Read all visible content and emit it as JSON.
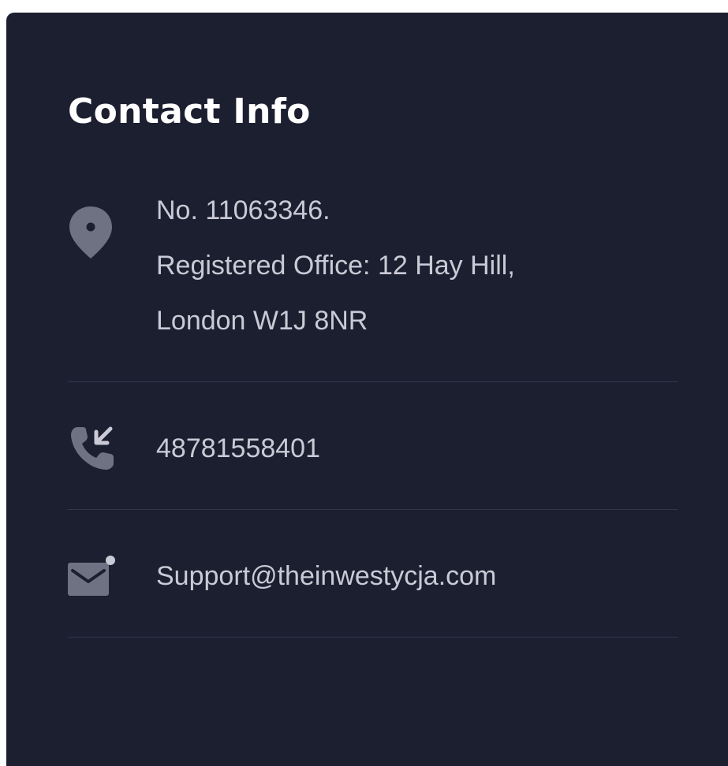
{
  "contact": {
    "title": "Contact Info",
    "address": {
      "icon": "location-pin-icon",
      "lines": [
        "No. 11063346.",
        "Registered Office: 12 Hay Hill,",
        "London W1J 8NR"
      ]
    },
    "phone": {
      "icon": "phone-incoming-icon",
      "value": "48781558401"
    },
    "email": {
      "icon": "mail-icon",
      "value": "Support@theinwestycja.com"
    }
  },
  "colors": {
    "card_background": "#1c1f30",
    "title": "#ffffff",
    "text": "#c9cad5",
    "icon": "#6f7282",
    "divider": "#34374a"
  }
}
